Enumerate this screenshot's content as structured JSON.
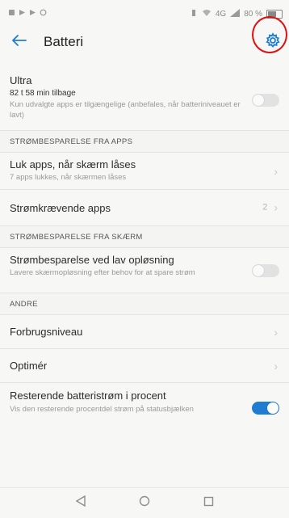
{
  "status_bar": {
    "left_icons": [
      "notification-icon",
      "notification-icon",
      "notification-icon",
      "alarm-icon"
    ],
    "signal_text": "4G",
    "battery_percent_text": "80 %"
  },
  "app_bar": {
    "title": "Batteri"
  },
  "ultra": {
    "title": "Ultra",
    "time_left": "82 t 58 min tilbage",
    "description": "Kun udvalgte apps er tilgængelige (anbefales, når batteriniveauet er lavt)",
    "toggle_on": false
  },
  "section_apps": {
    "header": "STRØMBESPARELSE FRA APPS",
    "close_apps": {
      "title": "Luk apps, når skærm låses",
      "subtitle": "7 apps lukkes, når skærmen låses"
    },
    "power_apps": {
      "title": "Strømkrævende apps",
      "count": "2"
    }
  },
  "section_screen": {
    "header": "STRØMBESPARELSE FRA SKÆRM",
    "low_res": {
      "title": "Strømbesparelse ved lav opløsning",
      "subtitle": "Lavere skærmopløsning efter behov for at spare strøm",
      "toggle_on": false
    }
  },
  "section_other": {
    "header": "ANDRE",
    "usage": {
      "title": "Forbrugsniveau"
    },
    "optimize": {
      "title": "Optimér"
    },
    "percent": {
      "title": "Resterende batteristrøm i procent",
      "subtitle": "Vis den resterende procentdel strøm på statusbjælken",
      "toggle_on": true
    }
  },
  "colors": {
    "accent": "#1f7cd3",
    "annotation_circle": "#d11111"
  }
}
